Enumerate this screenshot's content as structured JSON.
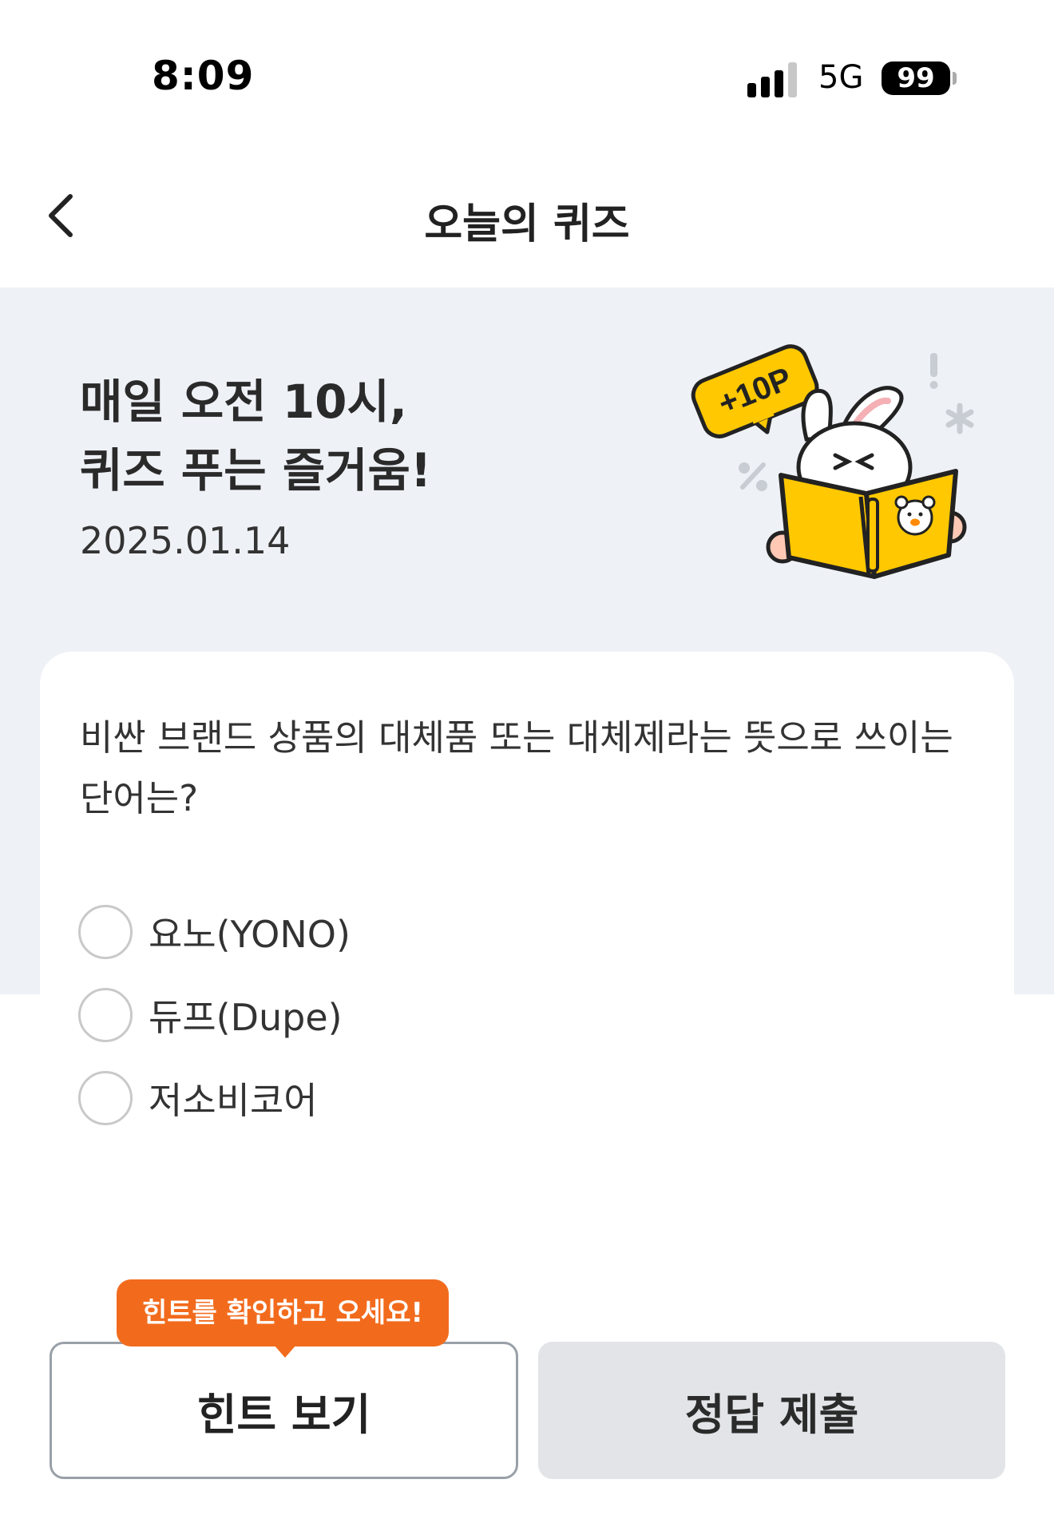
{
  "status": {
    "time": "8:09",
    "network": "5G",
    "battery": "99"
  },
  "nav": {
    "title": "오늘의 퀴즈"
  },
  "hero": {
    "title": "매일 오전 10시,\n퀴즈 푸는 즐거움!",
    "date": "2025.01.14",
    "badge": "+10P"
  },
  "quiz": {
    "question": "비싼 브랜드 상품의 대체품 또는 대체제라는 뜻으로 쓰이는 단어는?",
    "options": [
      {
        "label": "요노(YONO)"
      },
      {
        "label": "듀프(Dupe)"
      },
      {
        "label": "저소비코어"
      }
    ]
  },
  "tooltip": {
    "text": "힌트를 확인하고 오세요!"
  },
  "buttons": {
    "hint": "힌트 보기",
    "submit": "정답 제출"
  },
  "colors": {
    "accent_orange": "#f26b1d",
    "book_yellow": "#ffc800",
    "hero_bg": "#eef1f6"
  }
}
